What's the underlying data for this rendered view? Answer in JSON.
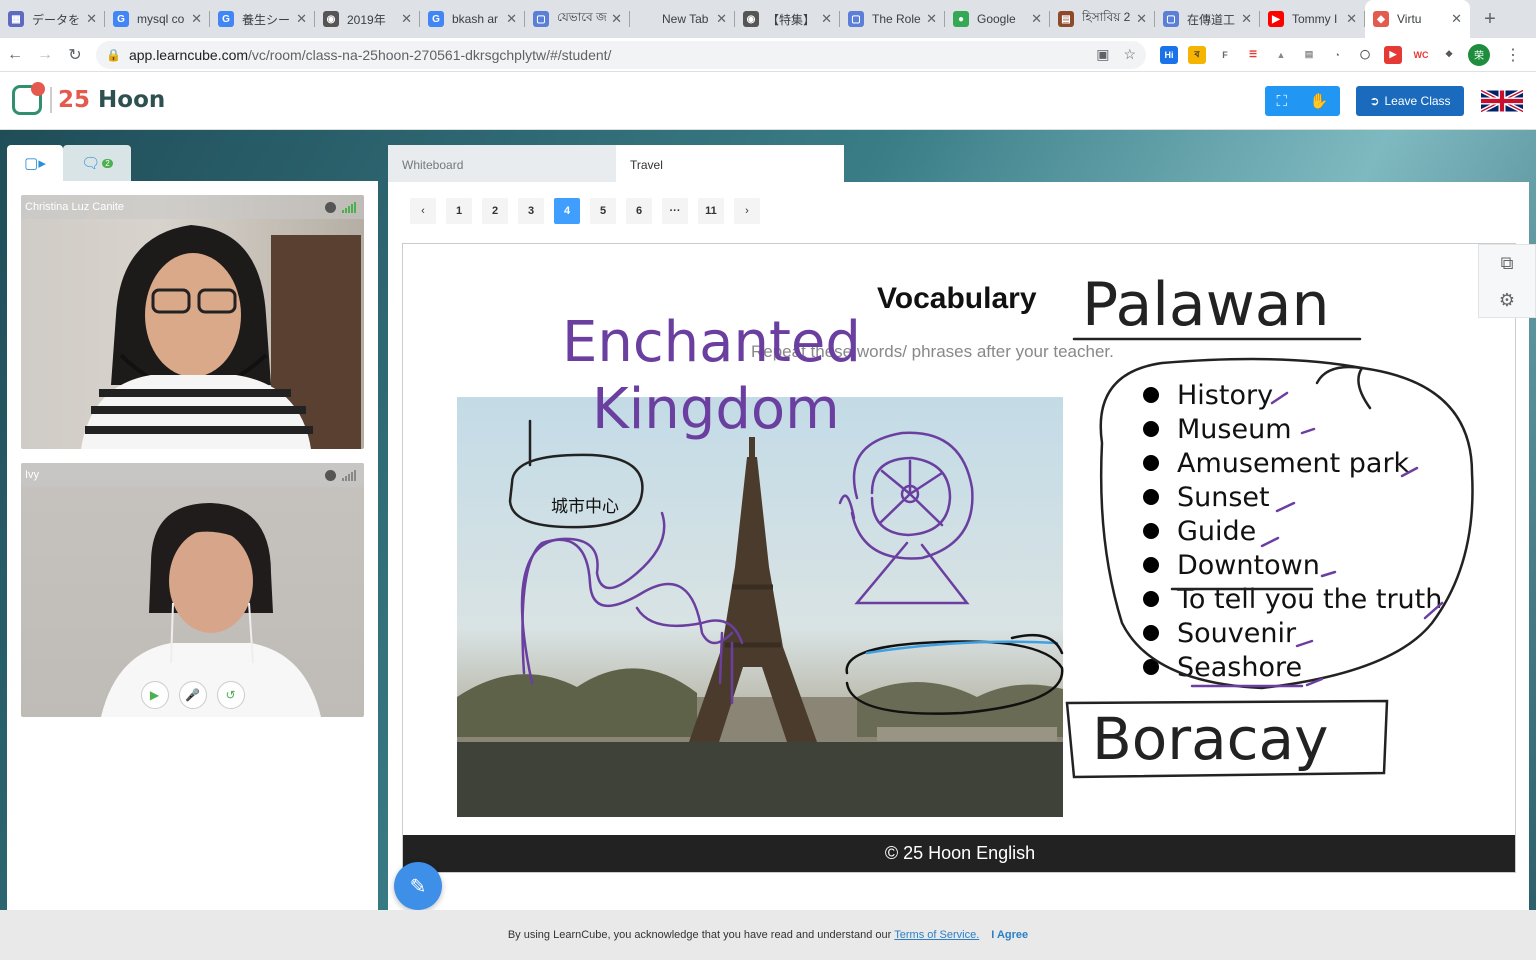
{
  "browser": {
    "tabs": [
      {
        "title": "データを",
        "color": "#5c6bc0",
        "icon": "grid"
      },
      {
        "title": "mysql co",
        "color": "#4285f4",
        "icon": "G"
      },
      {
        "title": "養生シー",
        "color": "#4285f4",
        "icon": "G"
      },
      {
        "title": "2019年",
        "color": "#555555",
        "icon": "globe"
      },
      {
        "title": "bkash ar",
        "color": "#4285f4",
        "icon": "G"
      },
      {
        "title": "যেভাবে জ",
        "color": "#5b7fd6",
        "icon": "doc"
      },
      {
        "title": "New Tab",
        "color": "",
        "icon": ""
      },
      {
        "title": "【特集】",
        "color": "#555555",
        "icon": "globe"
      },
      {
        "title": "The Role",
        "color": "#5b7fd6",
        "icon": "doc"
      },
      {
        "title": "Google",
        "color": "#34a853",
        "icon": "pin"
      },
      {
        "title": "হিসাবিয় 2",
        "color": "#8d4a2b",
        "icon": "book"
      },
      {
        "title": "在傳道工",
        "color": "#5b7fd6",
        "icon": "doc"
      },
      {
        "title": "Tommy I",
        "color": "#ff0000",
        "icon": "play"
      },
      {
        "title": "Virtu",
        "color": "#e45a4f",
        "icon": "cube"
      }
    ],
    "active_tab_index": 13,
    "url_host": "app.learncube.com",
    "url_path": "/vc/room/class-na-25hoon-270561-dkrsgchplytw/#/student/",
    "profile_initial": "荣"
  },
  "app": {
    "logo_num": "25",
    "logo_word": "Hoon",
    "leave_label": "Leave Class",
    "flag": "uk-flag"
  },
  "side": {
    "chat_badge": "2",
    "videos": [
      {
        "name": "Christina Luz Canite"
      },
      {
        "name": "Ivy"
      }
    ]
  },
  "whiteboard": {
    "tabs": [
      "Whiteboard",
      "Travel"
    ],
    "active_tab": "Travel",
    "pages": [
      "1",
      "2",
      "3",
      "4",
      "5",
      "6",
      "···",
      "11"
    ],
    "current_page": "4"
  },
  "slide": {
    "title": "Vocabulary",
    "subtitle": "Repeat these words/ phrases after your teacher.",
    "words": [
      "History",
      "Museum",
      "Amusement park",
      "Sunset",
      "Guide",
      "Downtown",
      "To tell you the truth",
      "Souvenir",
      "Seashore"
    ],
    "footer": "© 25 Hoon English",
    "photo_subject": "eiffel-tower"
  },
  "annotations": {
    "handwritten": [
      "Palawan",
      "Enchanted",
      "Kingdom",
      "Boracay"
    ],
    "typed_label": "城市中心",
    "ink_color": "#6b3fa0"
  },
  "cookie": {
    "text": "By using LearnCube, you acknowledge that you have read and understand our",
    "link": "Terms of Service.",
    "agree": "I Agree"
  }
}
